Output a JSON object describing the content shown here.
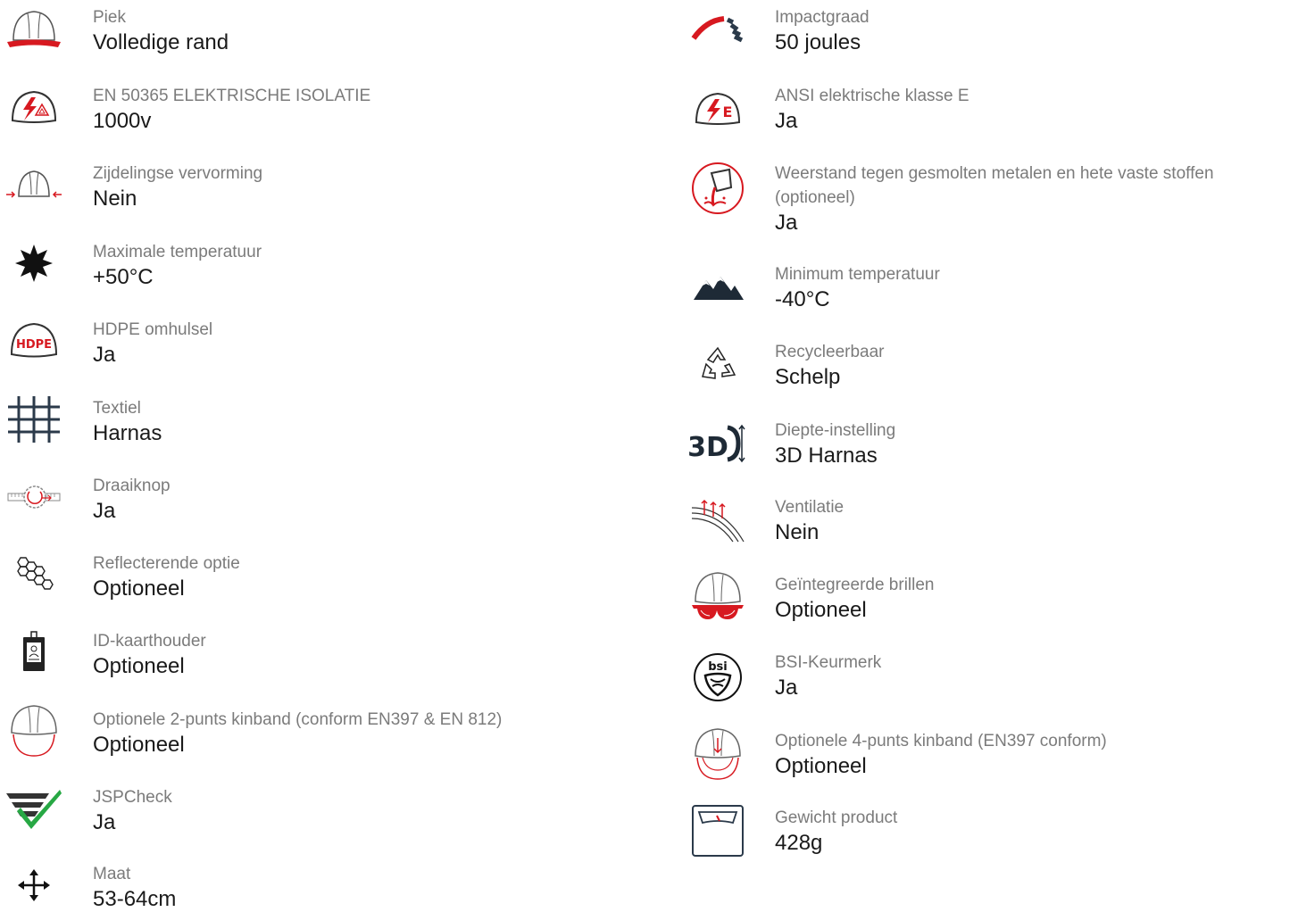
{
  "colors": {
    "accent_red": "#d71920",
    "label_grey": "#7b7b7b",
    "value_dark": "#1a1a1a",
    "icon_navy": "#2b3a4a",
    "check_green": "#27a844"
  },
  "left_features": [
    {
      "icon": "helmet-full-brim-icon",
      "label": "Piek",
      "value": "Volledige rand"
    },
    {
      "icon": "electrical-insulation-icon",
      "label": "EN 50365 ELEKTRISCHE ISOLATIE",
      "value": "1000v"
    },
    {
      "icon": "lateral-deformation-icon",
      "label": "Zijdelingse vervorming",
      "value": "Nein"
    },
    {
      "icon": "sun-icon",
      "label": "Maximale temperatuur",
      "value": "+50°C"
    },
    {
      "icon": "hdpe-helmet-icon",
      "icon_text": "HDPE",
      "label": "HDPE omhulsel",
      "value": "Ja"
    },
    {
      "icon": "textile-grid-icon",
      "label": "Textiel",
      "value": "Harnas"
    },
    {
      "icon": "ratchet-knob-icon",
      "label": "Draaiknop",
      "value": "Ja"
    },
    {
      "icon": "honeycomb-icon",
      "label": "Reflecterende optie",
      "value": "Optioneel"
    },
    {
      "icon": "id-card-holder-icon",
      "label": "ID-kaarthouder",
      "value": "Optioneel"
    },
    {
      "icon": "helmet-2-point-chinstrap-icon",
      "label": "Optionele 2-punts kinband (conform EN397 & EN 812)",
      "value": "Optioneel"
    },
    {
      "icon": "jspcheck-icon",
      "label": "JSPCheck",
      "value": "Ja"
    },
    {
      "icon": "move-arrows-icon",
      "label": "Maat",
      "value": "53-64cm"
    }
  ],
  "right_features": [
    {
      "icon": "impact-gauge-icon",
      "label": "Impactgraad",
      "value": "50 joules"
    },
    {
      "icon": "ansi-class-e-icon",
      "icon_text": "E",
      "label": "ANSI elektrische klasse E",
      "value": "Ja"
    },
    {
      "icon": "molten-metal-icon",
      "label": "Weerstand tegen gesmolten metalen en hete vaste stoffen (optioneel)",
      "value": "Ja"
    },
    {
      "icon": "mountains-icon",
      "label": "Minimum temperatuur",
      "value": "-40°C"
    },
    {
      "icon": "recycle-icon",
      "label": "Recycleerbaar",
      "value": "Schelp"
    },
    {
      "icon": "3d-depth-icon",
      "icon_text": "3D",
      "label": "Diepte-instelling",
      "value": "3D Harnas"
    },
    {
      "icon": "ventilation-icon",
      "label": "Ventilatie",
      "value": "Nein"
    },
    {
      "icon": "integrated-goggles-icon",
      "label": "Geïntegreerde brillen",
      "value": "Optioneel"
    },
    {
      "icon": "bsi-kitemark-icon",
      "icon_text": "bsi",
      "label": "BSI-Keurmerk",
      "value": "Ja"
    },
    {
      "icon": "helmet-4-point-chinstrap-icon",
      "label": "Optionele 4-punts kinband (EN397 conform)",
      "value": "Optioneel"
    },
    {
      "icon": "weighing-scale-icon",
      "label": "Gewicht product",
      "value": "428g"
    }
  ]
}
